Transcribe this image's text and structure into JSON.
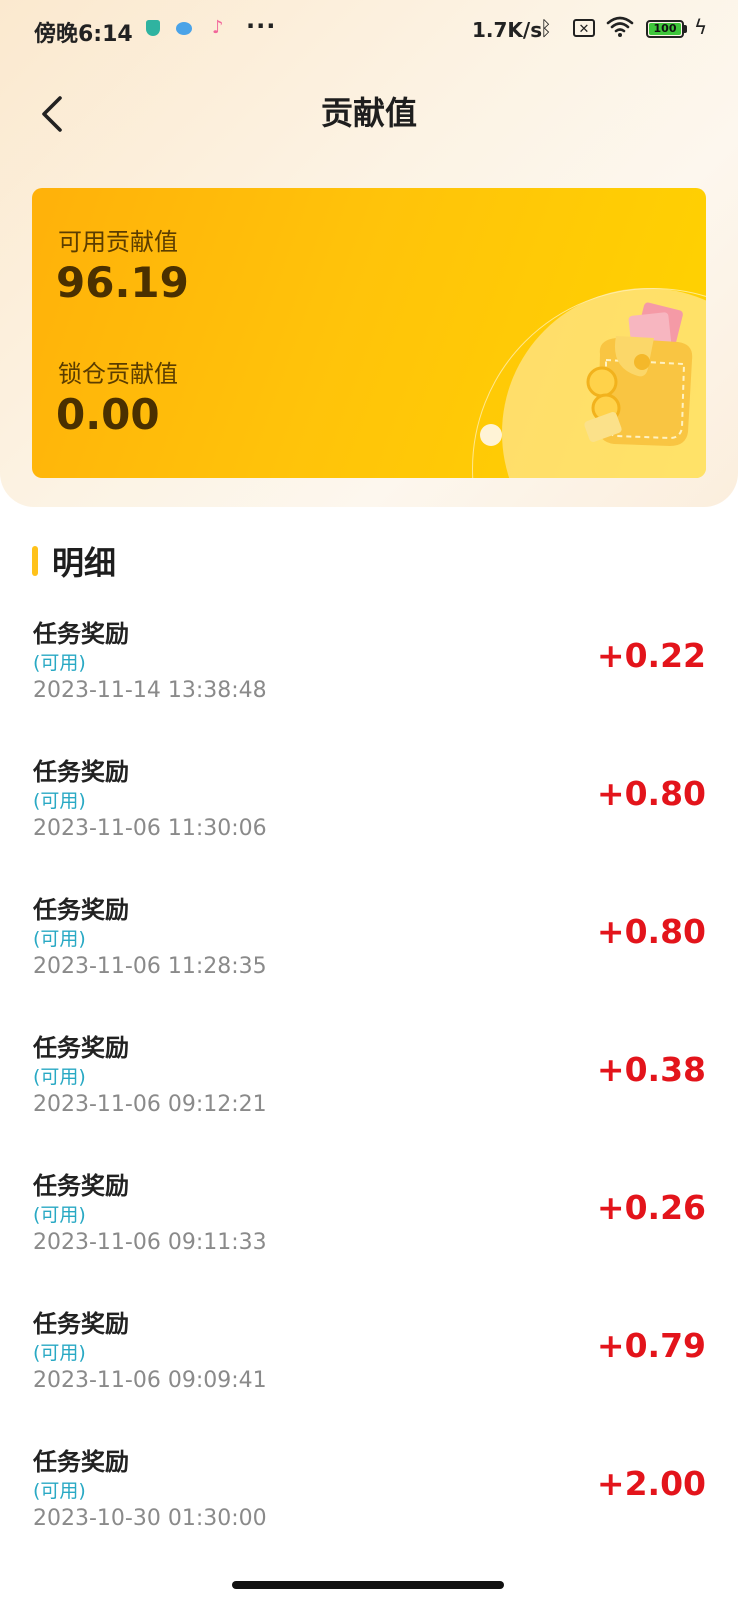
{
  "status_bar": {
    "time": "傍晚6:14",
    "more": "···",
    "net_speed": "1.7K/s",
    "battery_level": "100",
    "icons": [
      "shield-icon",
      "bubble-icon",
      "music-icon",
      "bluetooth-icon",
      "sim-icon",
      "wifi-icon",
      "battery-icon",
      "charging-icon"
    ]
  },
  "header": {
    "back_icon": "chevron-left-icon",
    "title": "贡献值"
  },
  "card": {
    "available_label": "可用贡献值",
    "available_value": "96.19",
    "locked_label": "锁仓贡献值",
    "locked_value": "0.00",
    "illustration": "wallet-icon",
    "colors": {
      "start": "#ffb10a",
      "end": "#ffd300"
    }
  },
  "detail": {
    "title": "明细",
    "records": [
      {
        "title": "任务奖励",
        "status": "(可用)",
        "time": "2023-11-14 13:38:48",
        "amount": "+0.22"
      },
      {
        "title": "任务奖励",
        "status": "(可用)",
        "time": "2023-11-06 11:30:06",
        "amount": "+0.80"
      },
      {
        "title": "任务奖励",
        "status": "(可用)",
        "time": "2023-11-06 11:28:35",
        "amount": "+0.80"
      },
      {
        "title": "任务奖励",
        "status": "(可用)",
        "time": "2023-11-06 09:12:21",
        "amount": "+0.38"
      },
      {
        "title": "任务奖励",
        "status": "(可用)",
        "time": "2023-11-06 09:11:33",
        "amount": "+0.26"
      },
      {
        "title": "任务奖励",
        "status": "(可用)",
        "time": "2023-11-06 09:09:41",
        "amount": "+0.79"
      },
      {
        "title": "任务奖励",
        "status": "(可用)",
        "time": "2023-10-30 01:30:00",
        "amount": "+2.00"
      }
    ]
  },
  "colors": {
    "amount": "#e3141b",
    "status": "#29a9c4",
    "accent": "#ffc21a"
  }
}
